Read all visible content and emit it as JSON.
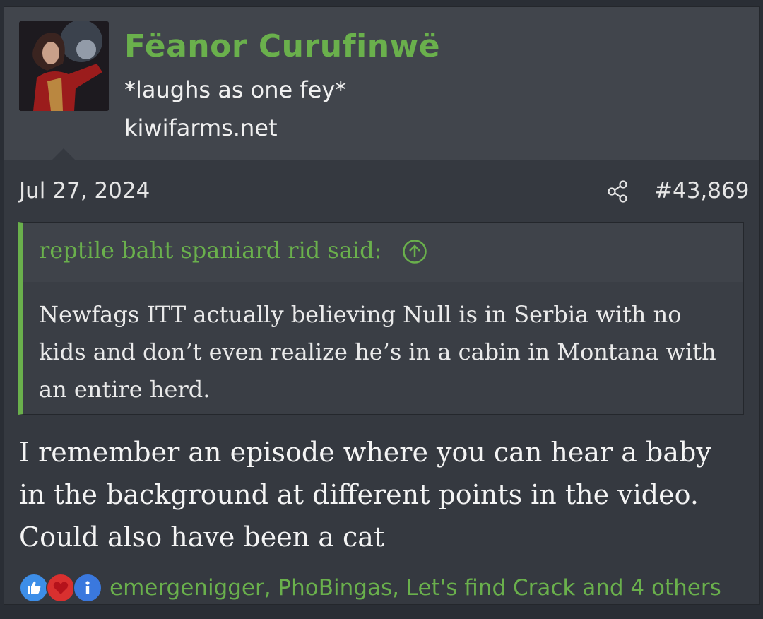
{
  "user": {
    "name": "Fëanor Curufinwë",
    "title": "*laughs as one fey*",
    "banner": "kiwifarms.net"
  },
  "post": {
    "date": "Jul 27, 2024",
    "number": "#43,869",
    "share_icon": "share-icon"
  },
  "quote": {
    "author": "reptile baht spaniard rid said:",
    "up_icon": "arrow-up-circle-icon",
    "lines": [
      "Newfags ITT actually believing Null is in Serbia with no",
      "kids and don’t even realize he’s in a cabin in Montana with",
      "an entire herd."
    ]
  },
  "message": {
    "lines": [
      "I remember an episode where you can hear a baby",
      "in the background at different points in the video.",
      "Could also have been a cat"
    ]
  },
  "reactions": {
    "icons": [
      "like-icon",
      "love-icon",
      "informative-icon"
    ],
    "text": "emergenigger, PhoBingas, Let's find Crack and 4 others"
  },
  "colors": {
    "accent": "#6ab04c",
    "post_bg": "#353940",
    "user_block_bg": "#41454c"
  }
}
